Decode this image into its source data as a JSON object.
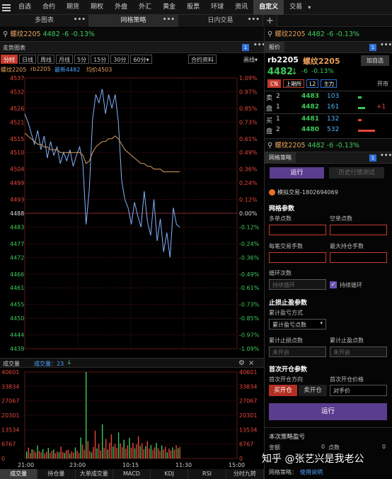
{
  "nav": {
    "items": [
      "自选",
      "合约",
      "期货",
      "期权",
      "外盘",
      "外汇",
      "黄金",
      "股票",
      "环球",
      "资讯",
      "自定义",
      "交易"
    ],
    "active_index": 10,
    "trade_arrow": "▾"
  },
  "tabs": {
    "t1": "多图表",
    "t2": "网格策略",
    "t3": "日内交易",
    "more": "•••",
    "add": "+"
  },
  "left_quote": {
    "name": "螺纹2205",
    "price": "4482",
    "change": "-6",
    "pct": "-0.13%"
  },
  "chart_header": {
    "title": "走势图表",
    "badge": "1",
    "periods": [
      "分时",
      "日线",
      "周线",
      "月线",
      "5分",
      "15分",
      "30分",
      "60分▾"
    ],
    "active_period": 0,
    "contract_info": "合约资料",
    "draw_line": "画线▾"
  },
  "chart_info": {
    "symbol": "螺纹2205",
    "code": "rb2205",
    "latest": "最新4482",
    "avg": "均价4503"
  },
  "volume_header": {
    "title": "成交量",
    "vol_label": "成交量：23"
  },
  "bottom_tabs": [
    "成交量",
    "持仓量",
    "大单成交量",
    "MACD",
    "KDJ",
    "RSI",
    "分时九转"
  ],
  "right_header": {
    "name": "螺纹2205",
    "price": "4482",
    "change": "-6",
    "pct": "-0.13%"
  },
  "quote_panel": {
    "tab": "报价",
    "badge": "1",
    "code": "rb2205",
    "name": "螺纹2205",
    "add_watch": "加自选",
    "price": "4482",
    "arrow": "↓",
    "change": "-6",
    "pct": "-0.13%",
    "tags": [
      "CN",
      "上期所",
      "L2",
      "主力"
    ],
    "status": "开市",
    "sell_label": [
      "卖",
      "盘"
    ],
    "buy_label": [
      "买",
      "盘"
    ],
    "asks": [
      {
        "lvl": "2",
        "price": "4483",
        "vol": "103",
        "delta": ""
      },
      {
        "lvl": "1",
        "price": "4482",
        "vol": "161",
        "delta": "+1"
      }
    ],
    "bids": [
      {
        "lvl": "1",
        "price": "4481",
        "vol": "132",
        "delta": ""
      },
      {
        "lvl": "2",
        "price": "4480",
        "vol": "532",
        "delta": ""
      }
    ]
  },
  "grid_panel": {
    "name": "螺纹2205",
    "price": "4482",
    "change": "-6",
    "pct": "-0.13%",
    "tab": "网格策略",
    "badge": "1",
    "run_tab": "运行",
    "backtest_tab": "历史行情测试",
    "account": "模拟交易-1802694069",
    "params_title": "网格参数",
    "multi_points": "多单点数",
    "short_points": "空单点数",
    "per_trade": "每笔交易手数",
    "max_pos": "最大持仓手数",
    "loop_count": "循环次数",
    "loop_placeholder": "持续循环",
    "loop_check_label": "持续循环",
    "sl_title": "止损止盈参数",
    "accum_mode": "累计盈亏方式",
    "accum_select": "累计盈亏点数",
    "accum_sl": "累计止损点数",
    "accum_tp": "累计止盈点数",
    "not_enabled": "未开启",
    "first_title": "首次开仓参数",
    "first_dir": "首次开仓方向",
    "first_price": "首次开仓价格",
    "buy_open": "买开仓",
    "sell_open": "卖开仓",
    "opp_price": "对手价",
    "run_button": "运行",
    "pnl_title": "本次策略盈亏",
    "amount_label": "金额",
    "amount_value": "0",
    "points_label": "点数",
    "points_value": "0",
    "footer_label": "网格策略：",
    "footer_link": "使用说明"
  },
  "watermark": "知乎 @张艺兴是我老公",
  "chart_data": [
    {
      "type": "line",
      "title": "",
      "y_left_ticks": [
        4537,
        4532,
        4526,
        4521,
        4515,
        4510,
        4504,
        4499,
        4493,
        4488,
        4483,
        4477,
        4472,
        4466,
        4461,
        4455,
        4450,
        4444,
        4439
      ],
      "y_right_ticks": [
        "1.09%",
        "0.97%",
        "0.85%",
        "0.73%",
        "0.61%",
        "0.49%",
        "0.36%",
        "0.24%",
        "0.12%",
        "0.00%",
        "-0.12%",
        "-0.24%",
        "-0.36%",
        "-0.49%",
        "-0.61%",
        "-0.73%",
        "-0.85%",
        "-0.97%",
        "-1.09%"
      ],
      "ylim": [
        4439,
        4537
      ],
      "reference_price": 4488,
      "series": [
        {
          "name": "最新",
          "values": [
            4524,
            4521,
            4517,
            4513,
            4518,
            4511,
            4516,
            4508,
            4514,
            4509,
            4512,
            4506,
            4510,
            4507,
            4511,
            4505,
            4509,
            4512,
            4506,
            4484,
            4497,
            4522,
            4531,
            4528,
            4533,
            4524,
            4531,
            4526,
            4531,
            4521,
            4500,
            4493,
            4490,
            4484,
            4492,
            4487,
            4483,
            4496,
            4485,
            4480,
            4493,
            4478,
            4486,
            4474,
            4481,
            4472,
            4490,
            4484,
            4483
          ]
        },
        {
          "name": "均价",
          "values": [
            4517,
            4516,
            4515,
            4514,
            4513,
            4513,
            4512,
            4512,
            4511,
            4511,
            4511,
            4510,
            4510,
            4510,
            4510,
            4510,
            4510,
            4510,
            4509,
            4506,
            4507,
            4510,
            4512,
            4513,
            4514,
            4514,
            4515,
            4515,
            4516,
            4515,
            4513,
            4511,
            4510,
            4509,
            4508,
            4507,
            4506,
            4506,
            4505,
            4505,
            4504,
            4504,
            4504,
            4503,
            4503,
            4503,
            4503,
            4503,
            4503
          ]
        }
      ]
    },
    {
      "type": "bar",
      "title": "成交量",
      "x_ticks": [
        "21:00",
        "23:00",
        "10:15",
        "11:30",
        "15:00"
      ],
      "y_ticks": [
        40601,
        33834,
        27067,
        20301,
        13534,
        6767,
        0
      ],
      "ylim": [
        0,
        40601
      ],
      "values": [
        3200,
        5100,
        2600,
        4300,
        3900,
        2800,
        6100,
        3500,
        2900,
        4400,
        2200,
        3100,
        5000,
        2700,
        3600,
        4200,
        2400,
        3300,
        2900,
        5600,
        3100,
        2600,
        3800,
        4100,
        2300,
        3400,
        2800,
        5200,
        3700,
        2600,
        9800,
        6500,
        4100,
        40601,
        8200,
        3600,
        2900,
        5400,
        13000,
        4700,
        6900,
        3800,
        16000,
        5100,
        9200,
        4200,
        7400,
        11300,
        5600,
        6800,
        4900,
        12200,
        7100,
        5300,
        8800,
        4600,
        6200,
        9700,
        5100,
        7400,
        4800,
        6600,
        10400,
        5900,
        7200,
        4300,
        5800,
        8100,
        4600,
        6300,
        3900,
        5200,
        7300,
        4800,
        3600,
        6100,
        4200,
        5500,
        2900,
        4700,
        3800,
        5200,
        4100,
        6200,
        4800,
        5400
      ]
    }
  ]
}
